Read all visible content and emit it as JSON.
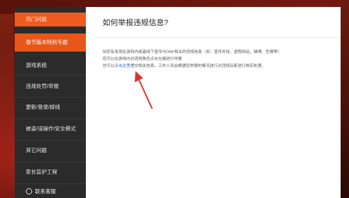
{
  "sidebar": {
    "items": [
      {
        "label": "热门问题"
      },
      {
        "label": "春节版本特别专题"
      },
      {
        "label": "游戏系统"
      },
      {
        "label": "违规处罚/举报"
      },
      {
        "label": "更新/登录/掉线"
      },
      {
        "label": "被盗/误操作/安全模式"
      },
      {
        "label": "其它问题"
      },
      {
        "label": "家长监护工程"
      },
      {
        "label": "联系客服"
      }
    ]
  },
  "main": {
    "title": "如何举报违规信息?",
    "line1": "如您有发现在游戏内或者线下宣传与DNF相关的违规信息（如：宣传外挂、虚假网站、赌博、色情等）",
    "line2": "您可以在游戏内对违规角色点击左键进行举报",
    "line3_prefix": "也可以",
    "line3_link": "点击这里",
    "line3_suffix": "提交相关信息，工作人员会根据您举报的情况进行对违规玩家进行核实处理。"
  },
  "colors": {
    "accent": "#ef5a1f",
    "link": "#2e6fd6",
    "arrow": "#e0332a",
    "sidebar_bg": "#2b2b2b"
  }
}
